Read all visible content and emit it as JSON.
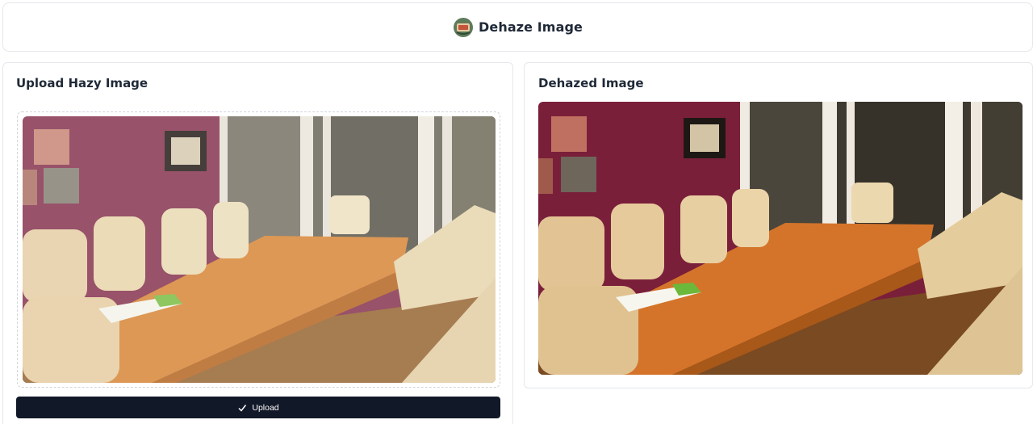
{
  "header": {
    "title": "Dehaze Image",
    "logo_icon": "dehaze-logo-icon"
  },
  "input_panel": {
    "title": "Upload Hazy Image",
    "image": "hazy dining room photo"
  },
  "output_panel": {
    "title": "Dehazed Image",
    "image": "dehazed dining room photo"
  },
  "upload_button": {
    "label": "Upload",
    "icon": "check-icon"
  },
  "colors": {
    "button_bg": "#111827",
    "wall": "#7a1f3a",
    "table": "#d9843a",
    "chair": "#e9d3a6",
    "border": "#e5e7eb"
  }
}
